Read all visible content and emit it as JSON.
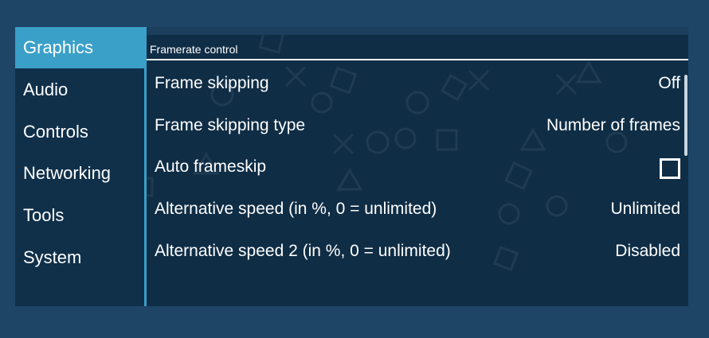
{
  "sidebar": {
    "items": [
      {
        "label": "Graphics",
        "active": true
      },
      {
        "label": "Audio",
        "active": false
      },
      {
        "label": "Controls",
        "active": false
      },
      {
        "label": "Networking",
        "active": false
      },
      {
        "label": "Tools",
        "active": false
      },
      {
        "label": "System",
        "active": false
      }
    ]
  },
  "section": {
    "title": "Framerate control"
  },
  "settings": [
    {
      "label": "Frame skipping",
      "value": "Off"
    },
    {
      "label": "Frame skipping type",
      "value": "Number of frames"
    },
    {
      "label": "Auto frameskip",
      "checked": false
    },
    {
      "label": "Alternative speed (in %, 0 = unlimited)",
      "value": "Unlimited"
    },
    {
      "label": "Alternative speed 2 (in %, 0 = unlimited)",
      "value": "Disabled"
    }
  ],
  "colors": {
    "accent": "#3aa0c8",
    "background": "#0f2d45",
    "outer": "#1e4466"
  }
}
